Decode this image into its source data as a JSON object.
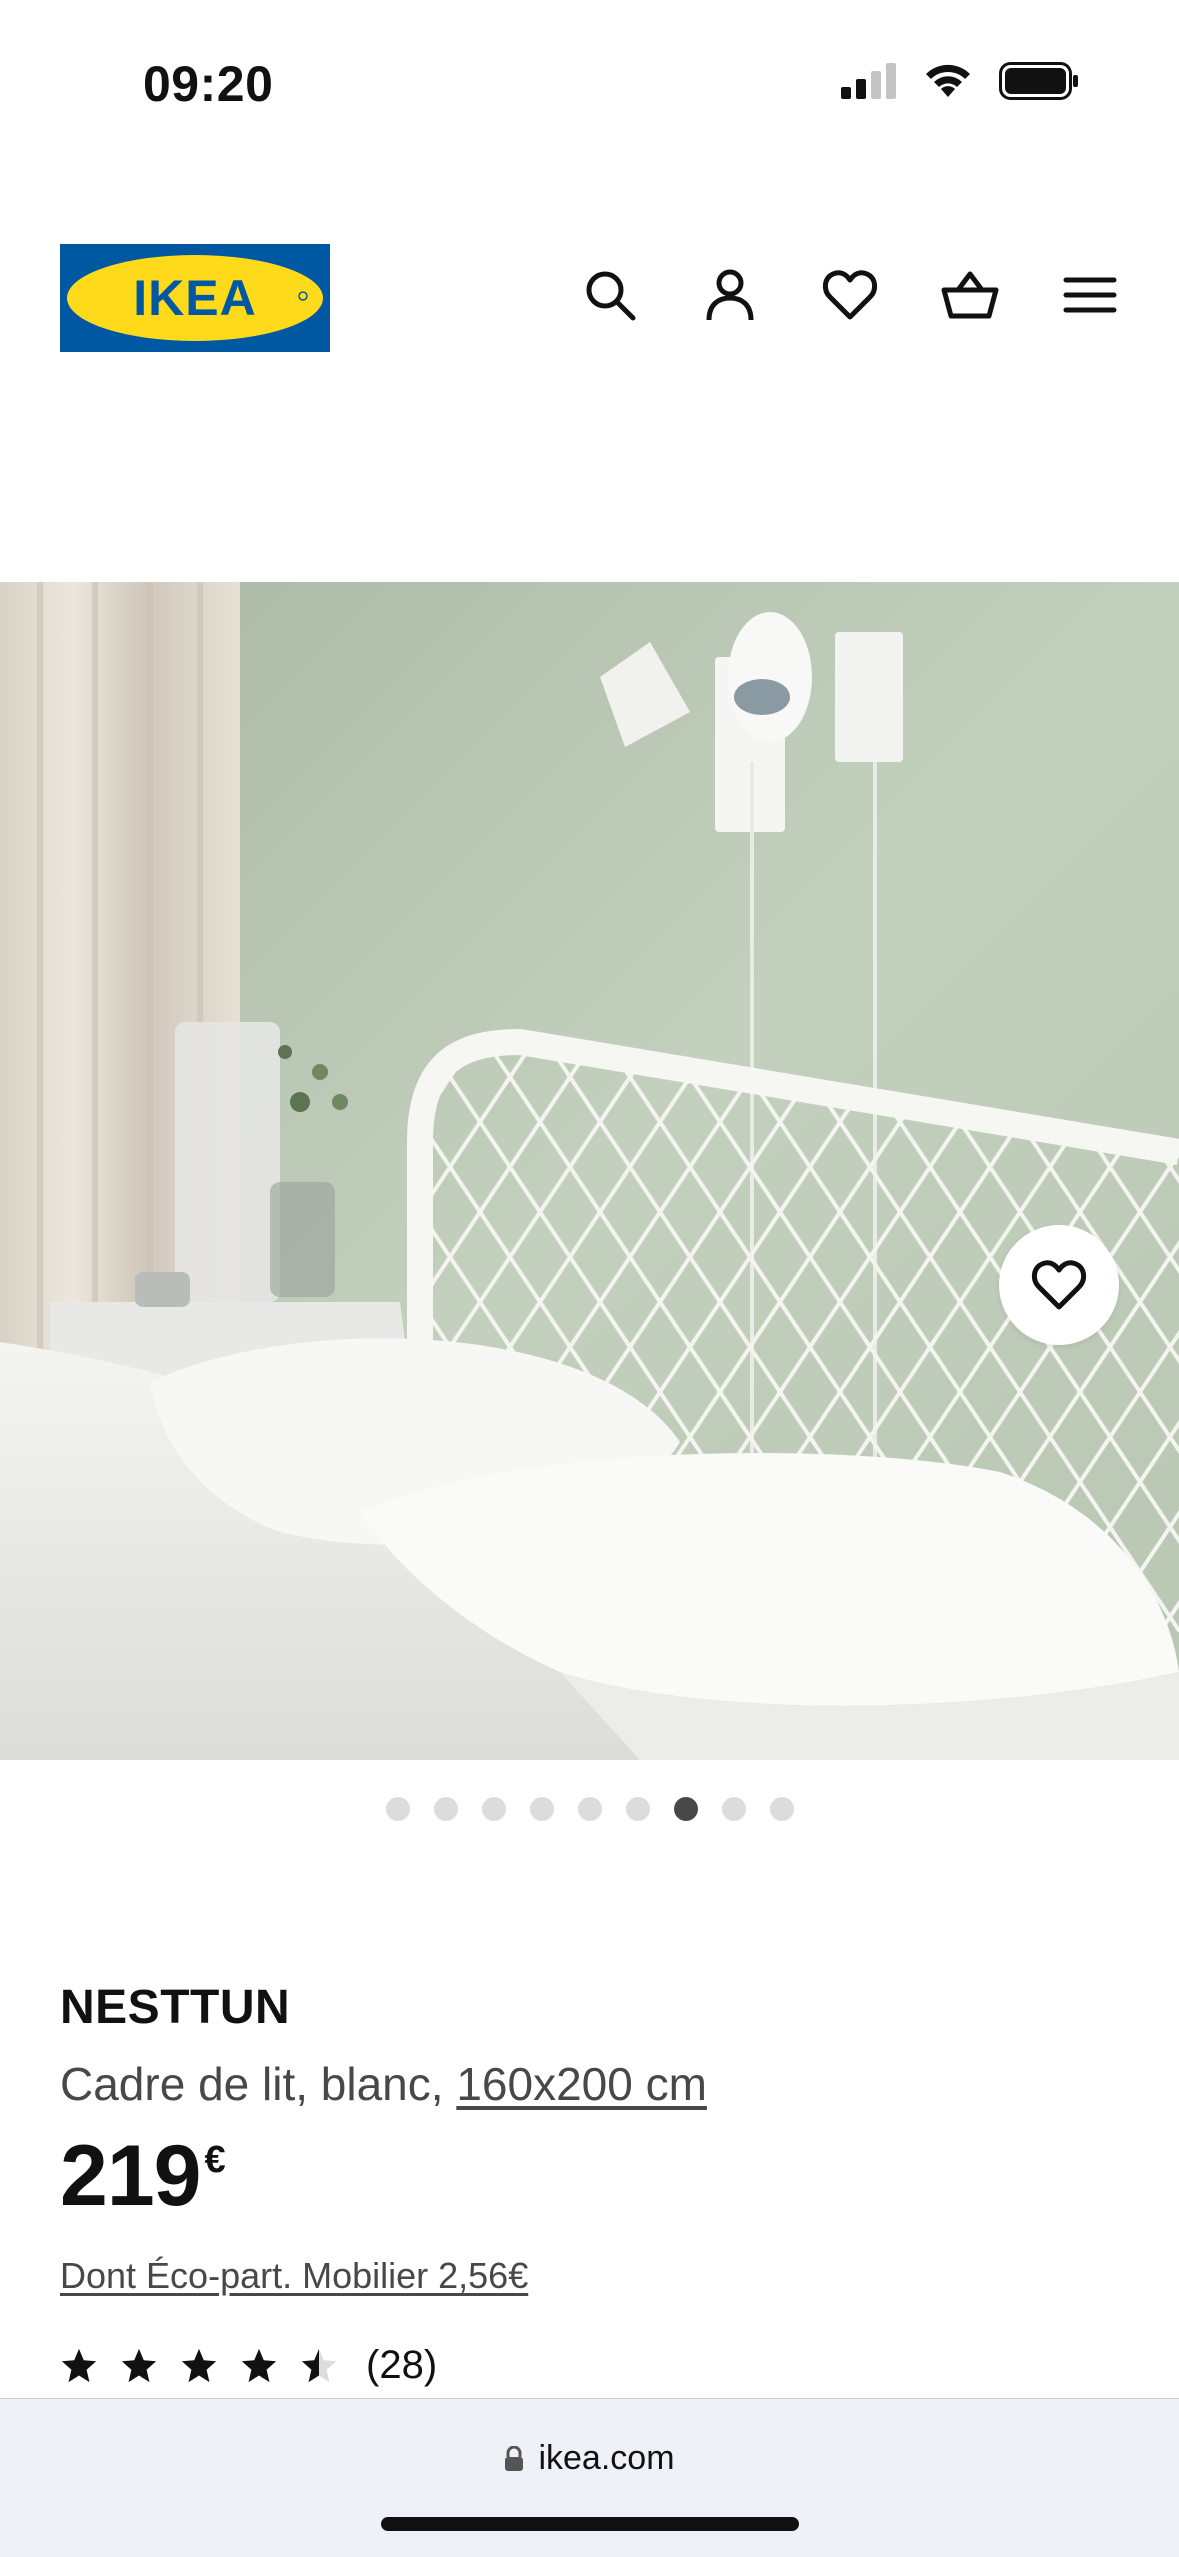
{
  "status_bar": {
    "time": "09:20",
    "signal_bars": 2,
    "battery_level": 1.0
  },
  "header": {
    "logo_text": "IKEA",
    "brand_colors": {
      "blue": "#0058A3",
      "yellow": "#FFDA1A"
    },
    "icons": [
      "search-icon",
      "account-icon",
      "heart-icon",
      "basket-icon",
      "menu-icon"
    ]
  },
  "gallery": {
    "slide_count": 9,
    "active_slide": 7,
    "favorite_icon": "heart-icon"
  },
  "product": {
    "name": "NESTTUN",
    "description": "Cadre de lit, blanc, ",
    "size": "160x200 cm",
    "price_integer": "219",
    "price_currency": "€",
    "eco_fee": "Dont Éco-part. Mobilier 2,56€",
    "rating_value": 4.5,
    "rating_max": 5,
    "review_count": "(28)"
  },
  "browser": {
    "url": "ikea.com",
    "lock_icon": "lock-icon"
  }
}
